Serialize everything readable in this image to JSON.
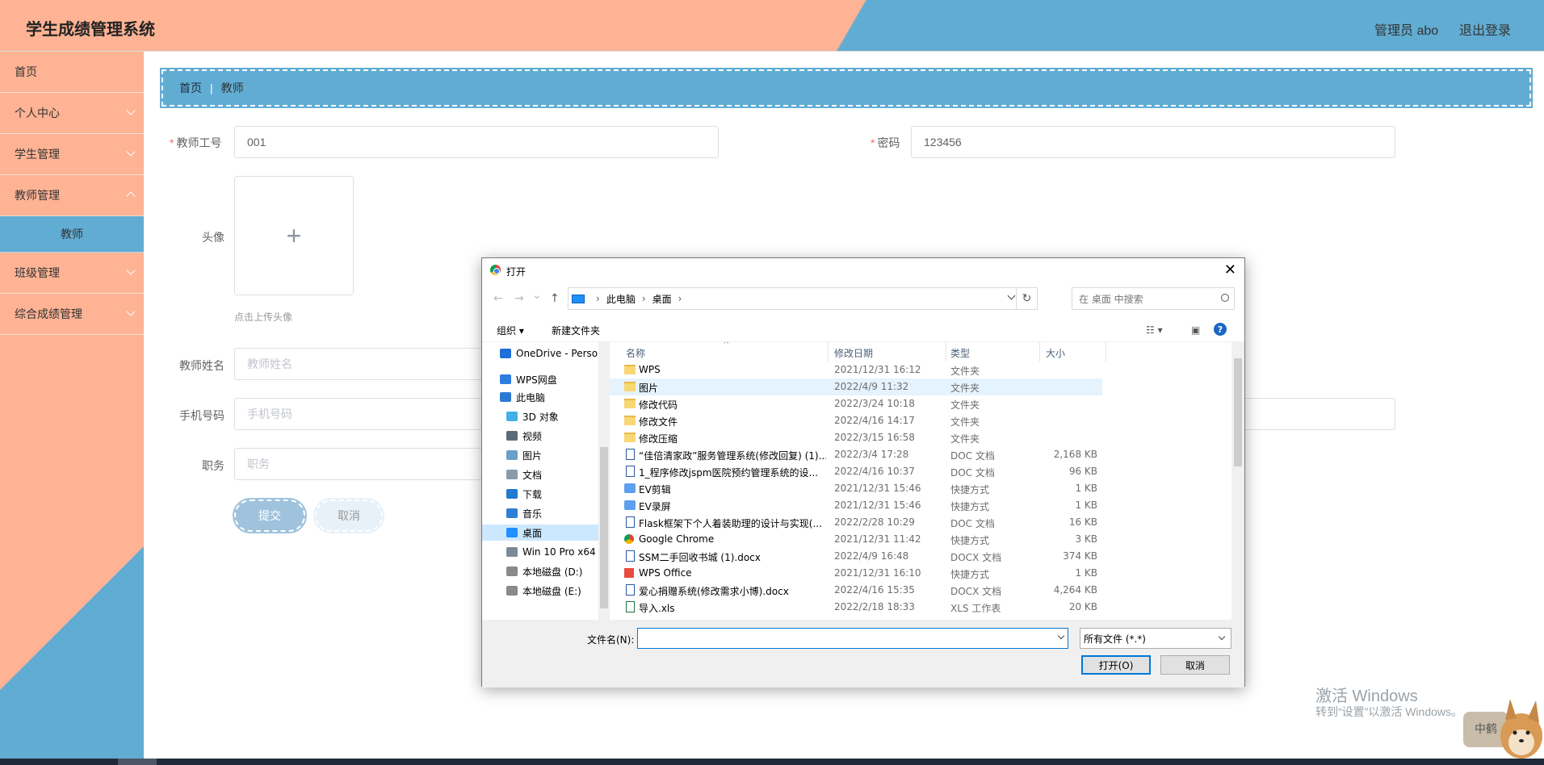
{
  "header": {
    "title": "学生成绩管理系统",
    "admin": "管理员 abo",
    "logout": "退出登录"
  },
  "sidebar": {
    "items": [
      {
        "label": "首页"
      },
      {
        "label": "个人中心"
      },
      {
        "label": "学生管理"
      },
      {
        "label": "教师管理"
      }
    ],
    "sub_active": "教师",
    "items2": [
      {
        "label": "班级管理"
      },
      {
        "label": "综合成绩管理"
      }
    ]
  },
  "breadcrumb": {
    "home": "首页",
    "sep": "|",
    "current": "教师"
  },
  "form": {
    "teacher_id_label": "教师工号",
    "teacher_id_value": "001",
    "password_label": "密码",
    "password_value": "123456",
    "avatar_label": "头像",
    "avatar_plus": "+",
    "avatar_hint": "点击上传头像",
    "name_label": "教师姓名",
    "name_placeholder": "教师姓名",
    "phone_label": "手机号码",
    "phone_placeholder": "手机号码",
    "position_label": "职务",
    "position_placeholder": "职务",
    "submit": "提交",
    "cancel": "取消"
  },
  "dialog": {
    "title": "打开",
    "close": "✕",
    "nav": {
      "back": "←",
      "forward": "→",
      "recent": "⌄",
      "up": "↑"
    },
    "path": [
      "此电脑",
      "桌面"
    ],
    "search_placeholder": "在 桌面 中搜索",
    "toolbar": {
      "organize": "组织 ▾",
      "new_folder": "新建文件夹",
      "help": "?"
    },
    "tree": [
      {
        "label": "OneDrive - Perso",
        "color": "#1e6fd9"
      },
      {
        "label": "WPS网盘",
        "color": "#2f7de1"
      },
      {
        "label": "此电脑",
        "color": "#2a7ad5"
      },
      {
        "label": "3D 对象",
        "color": "#43b0e8"
      },
      {
        "label": "视频",
        "color": "#5c6b7a"
      },
      {
        "label": "图片",
        "color": "#6aa0c8"
      },
      {
        "label": "文档",
        "color": "#8a9aaa"
      },
      {
        "label": "下载",
        "color": "#1f7ad1"
      },
      {
        "label": "音乐",
        "color": "#2d7fd6"
      },
      {
        "label": "桌面",
        "color": "#1e90ff"
      },
      {
        "label": "Win 10 Pro x64",
        "color": "#7b8a99"
      },
      {
        "label": "本地磁盘 (D:)",
        "color": "#8a8a8a"
      },
      {
        "label": "本地磁盘 (E:)",
        "color": "#8a8a8a"
      }
    ],
    "columns": {
      "name": "名称",
      "date": "修改日期",
      "type": "类型",
      "size": "大小"
    },
    "files": [
      {
        "icon": "folder",
        "name": "WPS",
        "date": "2021/12/31 16:12",
        "type": "文件夹",
        "size": ""
      },
      {
        "icon": "folder",
        "name": "图片",
        "date": "2022/4/9 11:32",
        "type": "文件夹",
        "size": ""
      },
      {
        "icon": "folder",
        "name": "修改代码",
        "date": "2022/3/24 10:18",
        "type": "文件夹",
        "size": ""
      },
      {
        "icon": "folder",
        "name": "修改文件",
        "date": "2022/4/16 14:17",
        "type": "文件夹",
        "size": ""
      },
      {
        "icon": "folder",
        "name": "修改压缩",
        "date": "2022/3/15 16:58",
        "type": "文件夹",
        "size": ""
      },
      {
        "icon": "doc",
        "name": "“佳倍清家政”服务管理系统(修改回复) (1)...",
        "date": "2022/3/4 17:28",
        "type": "DOC 文档",
        "size": "2,168 KB"
      },
      {
        "icon": "doc",
        "name": "1_程序修改jspm医院预约管理系统的设...",
        "date": "2022/4/16 10:37",
        "type": "DOC 文档",
        "size": "96 KB"
      },
      {
        "icon": "lnk",
        "name": "EV剪辑",
        "date": "2021/12/31 15:46",
        "type": "快捷方式",
        "size": "1 KB"
      },
      {
        "icon": "lnk",
        "name": "EV录屏",
        "date": "2021/12/31 15:46",
        "type": "快捷方式",
        "size": "1 KB"
      },
      {
        "icon": "doc",
        "name": "Flask框架下个人着装助理的设计与实现(...",
        "date": "2022/2/28 10:29",
        "type": "DOC 文档",
        "size": "16 KB"
      },
      {
        "icon": "chrome",
        "name": "Google Chrome",
        "date": "2021/12/31 11:42",
        "type": "快捷方式",
        "size": "3 KB"
      },
      {
        "icon": "doc",
        "name": "SSM二手回收书城 (1).docx",
        "date": "2022/4/9 16:48",
        "type": "DOCX 文档",
        "size": "374 KB"
      },
      {
        "icon": "wps",
        "name": "WPS Office",
        "date": "2021/12/31 16:10",
        "type": "快捷方式",
        "size": "1 KB"
      },
      {
        "icon": "doc",
        "name": "爱心捐赠系统(修改需求小博).docx",
        "date": "2022/4/16 15:35",
        "type": "DOCX 文档",
        "size": "4,264 KB"
      },
      {
        "icon": "xls",
        "name": "导入.xls",
        "date": "2022/2/18 18:33",
        "type": "XLS 工作表",
        "size": "20 KB"
      }
    ],
    "filename_label": "文件名(N):",
    "filename_value": "",
    "filetype": "所有文件 (*.*)",
    "open": "打开(O)",
    "cancel": "取消"
  },
  "watermark": {
    "line1": "激活 Windows",
    "line2": "转到“设置”以激活 Windows。"
  },
  "mascot_text": "中鹤"
}
